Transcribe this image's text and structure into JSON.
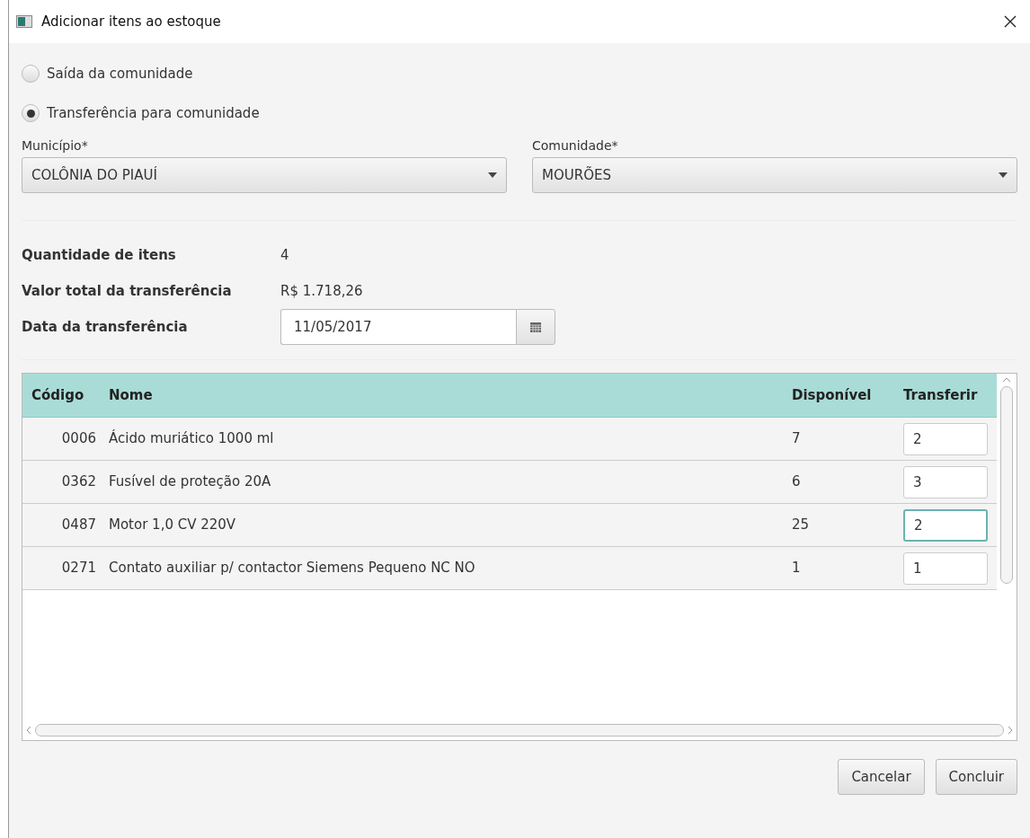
{
  "window": {
    "title": "Adicionar itens ao estoque"
  },
  "options": [
    {
      "label": "Saída da comunidade",
      "selected": false
    },
    {
      "label": "Transferência para comunidade",
      "selected": true
    }
  ],
  "fields": [
    {
      "label": "Município*",
      "value": "COLÔNIA DO PIAUÍ"
    },
    {
      "label": "Comunidade*",
      "value": "MOURÕES"
    }
  ],
  "summary": [
    {
      "label": "Quantidade de itens",
      "value": "4",
      "kind": "text"
    },
    {
      "label": "Valor total da transferência",
      "value": "R$ 1.718,26",
      "kind": "text"
    },
    {
      "label": "Data da transferência",
      "value": "11/05/2017",
      "kind": "date"
    }
  ],
  "table": {
    "columns": [
      "Código",
      "Nome",
      "Disponível",
      "Transferir"
    ],
    "rows": [
      {
        "code": "0006",
        "name": "Ácido muriático 1000 ml",
        "available": "7",
        "transfer": "2",
        "focused": false
      },
      {
        "code": "0362",
        "name": "Fusível de proteção 20A",
        "available": "6",
        "transfer": "3",
        "focused": false
      },
      {
        "code": "0487",
        "name": "Motor 1,0 CV 220V",
        "available": "25",
        "transfer": "2",
        "focused": true
      },
      {
        "code": "0271",
        "name": "Contato auxiliar p/ contactor Siemens Pequeno NC NO",
        "available": "1",
        "transfer": "1",
        "focused": false
      }
    ]
  },
  "buttons": [
    "Cancelar",
    "Concluir"
  ]
}
